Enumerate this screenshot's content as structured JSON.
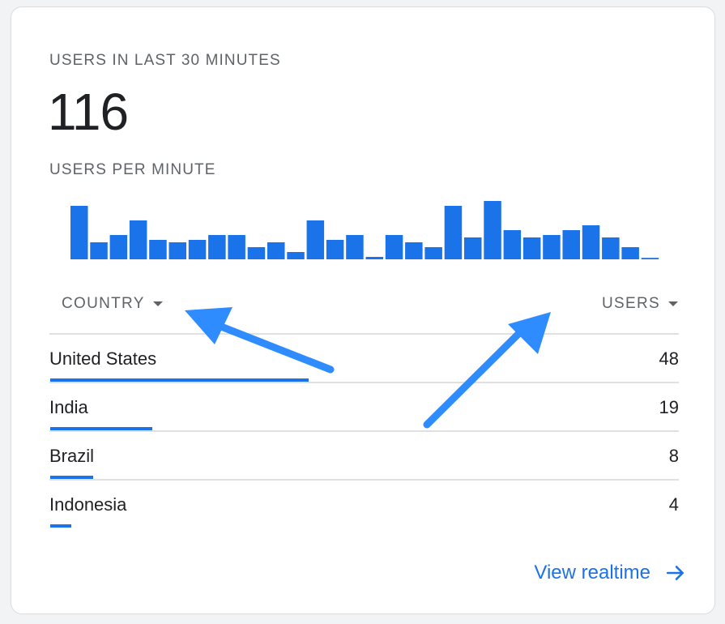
{
  "card": {
    "title": "USERS IN LAST 30 MINUTES",
    "total_users": "116",
    "per_minute_label": "USERS PER MINUTE"
  },
  "chart_data": {
    "type": "bar",
    "xlabel": "",
    "ylabel": "",
    "values": [
      11,
      3.5,
      5,
      8,
      4,
      3.5,
      4,
      5,
      5,
      2.5,
      3.5,
      1.5,
      8,
      4,
      5,
      0.5,
      5,
      3.5,
      2.5,
      11,
      4.5,
      12,
      6,
      4.5,
      5,
      6,
      7,
      4.5,
      2.5,
      0.3
    ],
    "ylim": [
      0,
      12
    ],
    "color": "#1a73e8"
  },
  "table": {
    "country_header": "COUNTRY",
    "users_header": "USERS",
    "rows": [
      {
        "country": "United States",
        "users": "48",
        "share": 1.0
      },
      {
        "country": "India",
        "users": "19",
        "share": 0.396
      },
      {
        "country": "Brazil",
        "users": "8",
        "share": 0.167
      },
      {
        "country": "Indonesia",
        "users": "4",
        "share": 0.083
      }
    ]
  },
  "footer": {
    "view_realtime": "View realtime",
    "arrow_icon": "arrow-right-icon"
  },
  "annotations": {
    "arrow_color": "#2f8cff"
  }
}
